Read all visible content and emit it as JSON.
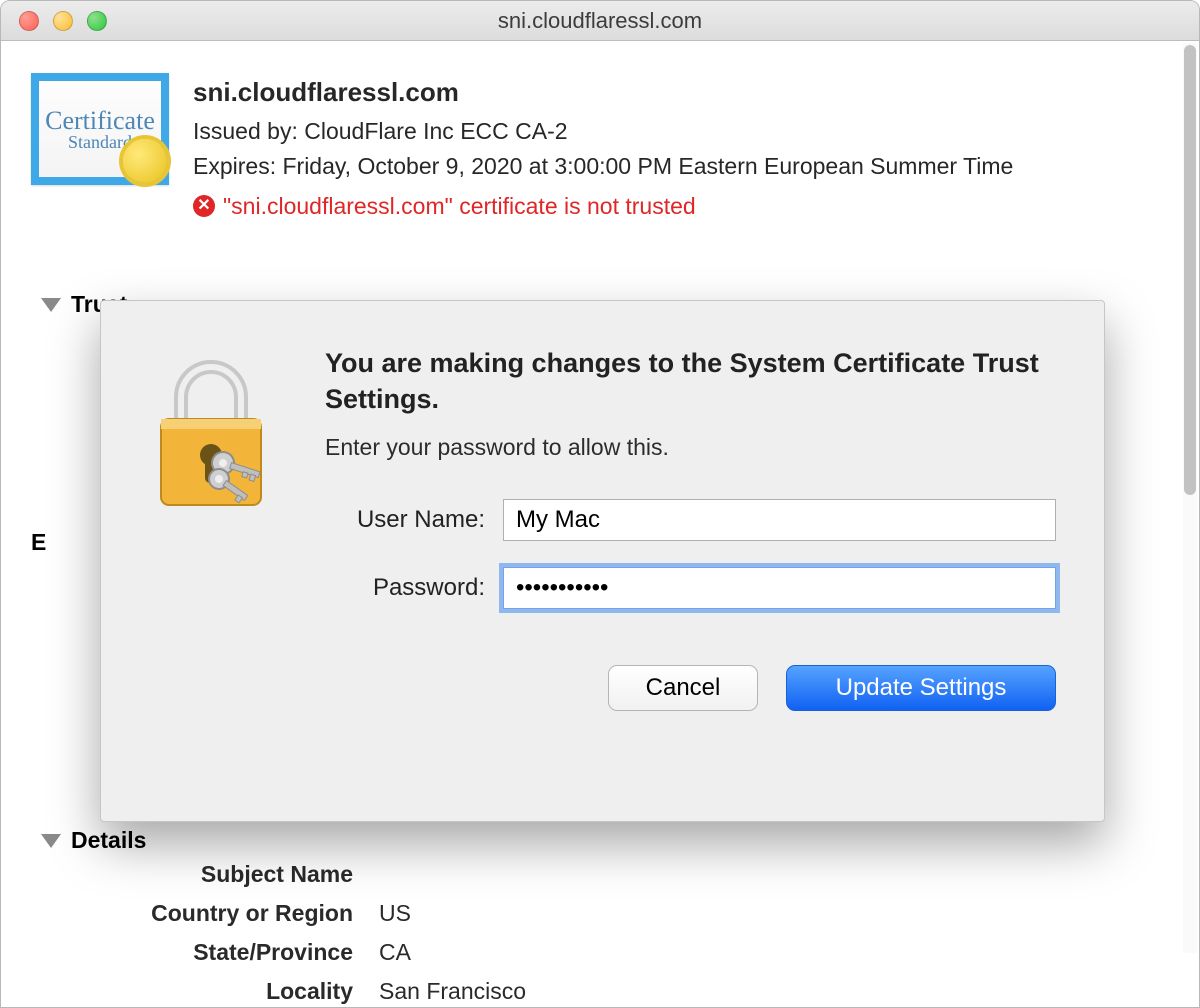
{
  "window": {
    "title": "sni.cloudflaressl.com"
  },
  "cert": {
    "name": "sni.cloudflaressl.com",
    "issued_by_label": "Issued by:",
    "issued_by": "CloudFlare Inc ECC CA-2",
    "expires_label": "Expires:",
    "expires": "Friday, October 9, 2020 at 3:00:00 PM Eastern European Summer Time",
    "warning": "\"sni.cloudflaressl.com\" certificate is not trusted",
    "icon_line1": "Certificate",
    "icon_line2": "Standard"
  },
  "sections": {
    "trust": "Trust",
    "details": "Details",
    "ext_fragment": "E"
  },
  "details": {
    "headings": {
      "subject_name": "Subject Name"
    },
    "labels": {
      "country": "Country or Region",
      "state": "State/Province",
      "locality": "Locality"
    },
    "values": {
      "country": "US",
      "state": "CA",
      "locality": "San Francisco"
    }
  },
  "modal": {
    "title": "You are making changes to the System Certificate Trust Settings.",
    "subtitle": "Enter your password to allow this.",
    "username_label": "User Name:",
    "username_value": "My Mac",
    "password_label": "Password:",
    "password_value": "•••••••••••",
    "cancel": "Cancel",
    "update": "Update Settings"
  }
}
